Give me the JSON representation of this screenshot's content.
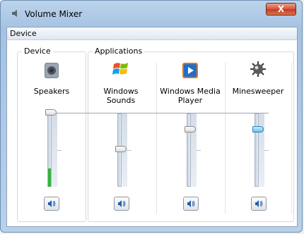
{
  "window": {
    "title": "Volume Mixer",
    "close_glyph": "X"
  },
  "menu": {
    "device": "Device"
  },
  "groups": {
    "device_legend": "Device",
    "applications_legend": "Applications"
  },
  "channels": [
    {
      "name": "Speakers",
      "icon": "speaker-icon",
      "volume": 100,
      "level": 0.25,
      "muted": false
    },
    {
      "name": "Windows Sounds",
      "line1": "Windows",
      "line2": "Sounds",
      "icon": "windows-flag-icon",
      "volume": 49,
      "muted": false
    },
    {
      "name": "Windows Media Player",
      "line1": "Windows Media",
      "line2": "Player",
      "icon": "media-player-icon",
      "volume": 83,
      "muted": false
    },
    {
      "name": "Minesweeper",
      "icon": "mine-icon",
      "volume": 83,
      "muted": false,
      "focused": true
    }
  ],
  "colors": {
    "accent": "#5fc2f0",
    "meter": "#36b33a"
  }
}
